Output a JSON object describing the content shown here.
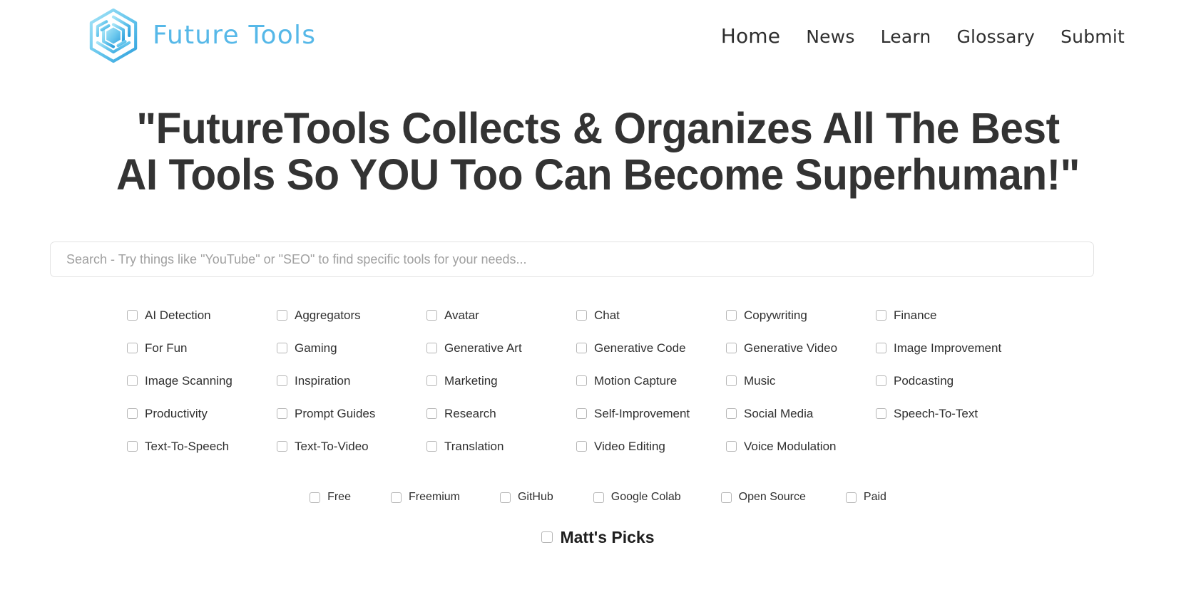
{
  "brand": {
    "name": "Future Tools",
    "logo_icon": "hexagon-maze-logo-icon",
    "logo_color_light": "#8fdcf5",
    "logo_color_dark": "#3aa7e0",
    "text_color": "#56b8e8"
  },
  "nav": {
    "items": [
      {
        "label": "Home",
        "active": true
      },
      {
        "label": "News",
        "active": false
      },
      {
        "label": "Learn",
        "active": false
      },
      {
        "label": "Glossary",
        "active": false
      },
      {
        "label": "Submit",
        "active": false
      }
    ]
  },
  "hero": {
    "line1": "\"FutureTools Collects & Organizes All The Best",
    "line2": "AI Tools So YOU Too Can Become Superhuman!\"",
    "color": "#333333"
  },
  "search": {
    "value": "",
    "placeholder": "Search - Try things like \"YouTube\" or \"SEO\" to find specific tools for your needs..."
  },
  "filters": {
    "categories": [
      "AI Detection",
      "Aggregators",
      "Avatar",
      "Chat",
      "Copywriting",
      "Finance",
      "For Fun",
      "Gaming",
      "Generative Art",
      "Generative Code",
      "Generative Video",
      "Image Improvement",
      "Image Scanning",
      "Inspiration",
      "Marketing",
      "Motion Capture",
      "Music",
      "Podcasting",
      "Productivity",
      "Prompt Guides",
      "Research",
      "Self-Improvement",
      "Social Media",
      "Speech-To-Text",
      "Text-To-Speech",
      "Text-To-Video",
      "Translation",
      "Video Editing",
      "Voice Modulation"
    ],
    "pricing": [
      "Free",
      "Freemium",
      "GitHub",
      "Google Colab",
      "Open Source",
      "Paid"
    ],
    "picks": "Matt's Picks",
    "checkbox_border_color": "#b6b6b6"
  }
}
